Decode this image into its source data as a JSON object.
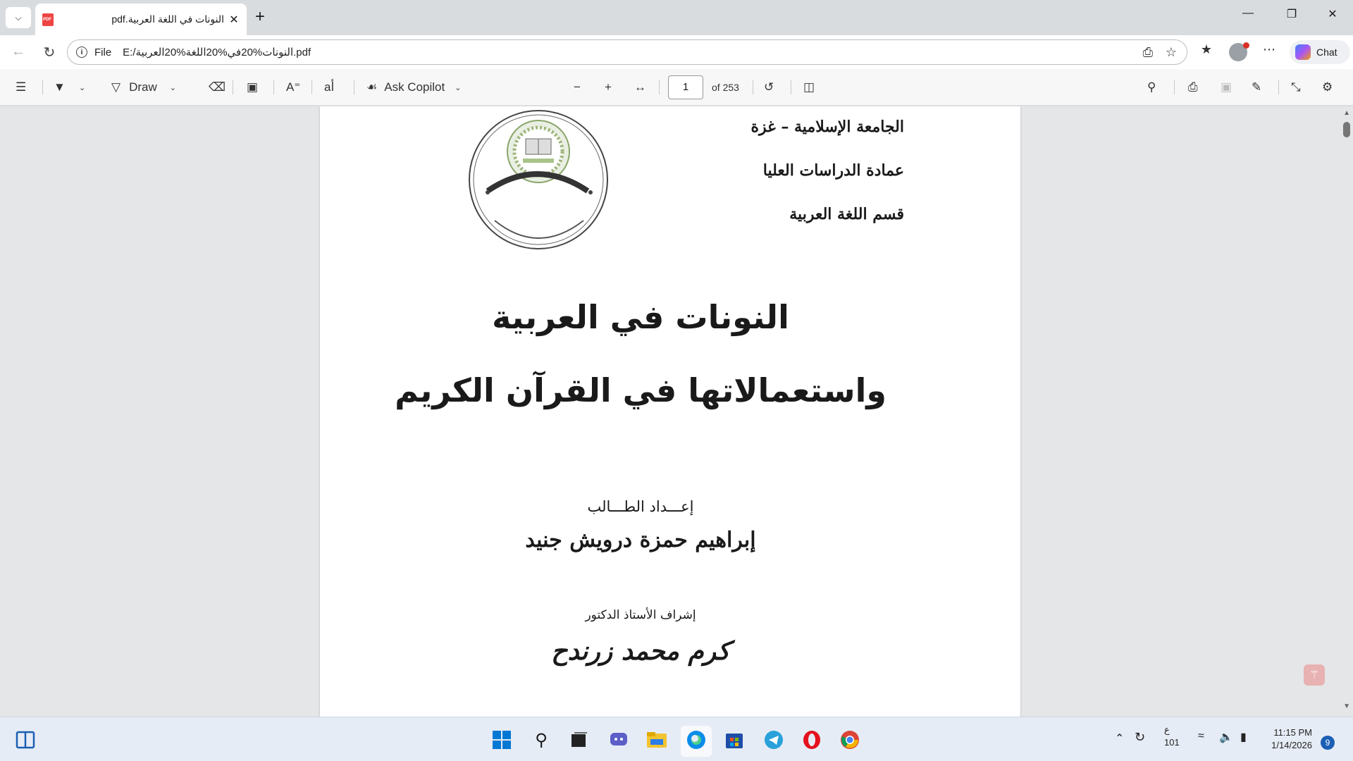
{
  "tab": {
    "title": "النونات في اللغة العربية.pdf",
    "close": "✕",
    "new_tab": "+"
  },
  "window": {
    "minimize": "—",
    "maximize": "❐",
    "close": "✕"
  },
  "address": {
    "scheme": "File",
    "url": "E:/النونات%20في%20اللغة%20العربية.pdf"
  },
  "copilot": {
    "label": "Chat"
  },
  "pdf_toolbar": {
    "draw_label": "Draw",
    "ask_copilot_label": "Ask Copilot",
    "page_current": "1",
    "page_total": "of 253"
  },
  "document": {
    "university": "الجامعة الإسلامية – غزة",
    "deanship": "عمادة الدراسات العليا",
    "department": "قسم اللغة العربية",
    "title_line1": "النونات في العربية",
    "title_line2": "واستعمالاتها في القرآن الكريم",
    "prepared_by_label": "إعـــداد الطـــالب",
    "student_name": "إبراهيم حمزة درويش جنيد",
    "supervisor_label": "إشراف الأستاذ الدكتور",
    "supervisor_name": "كرم محمد زرندح"
  },
  "taskbar": {
    "lang_top": "ع",
    "lang_bottom": "101",
    "time": "11:15 PM",
    "date": "1/14/2026",
    "notifications": "9"
  },
  "colors": {
    "accent": "#0f6cbd",
    "background": "#e5e6e8",
    "page": "#ffffff"
  }
}
